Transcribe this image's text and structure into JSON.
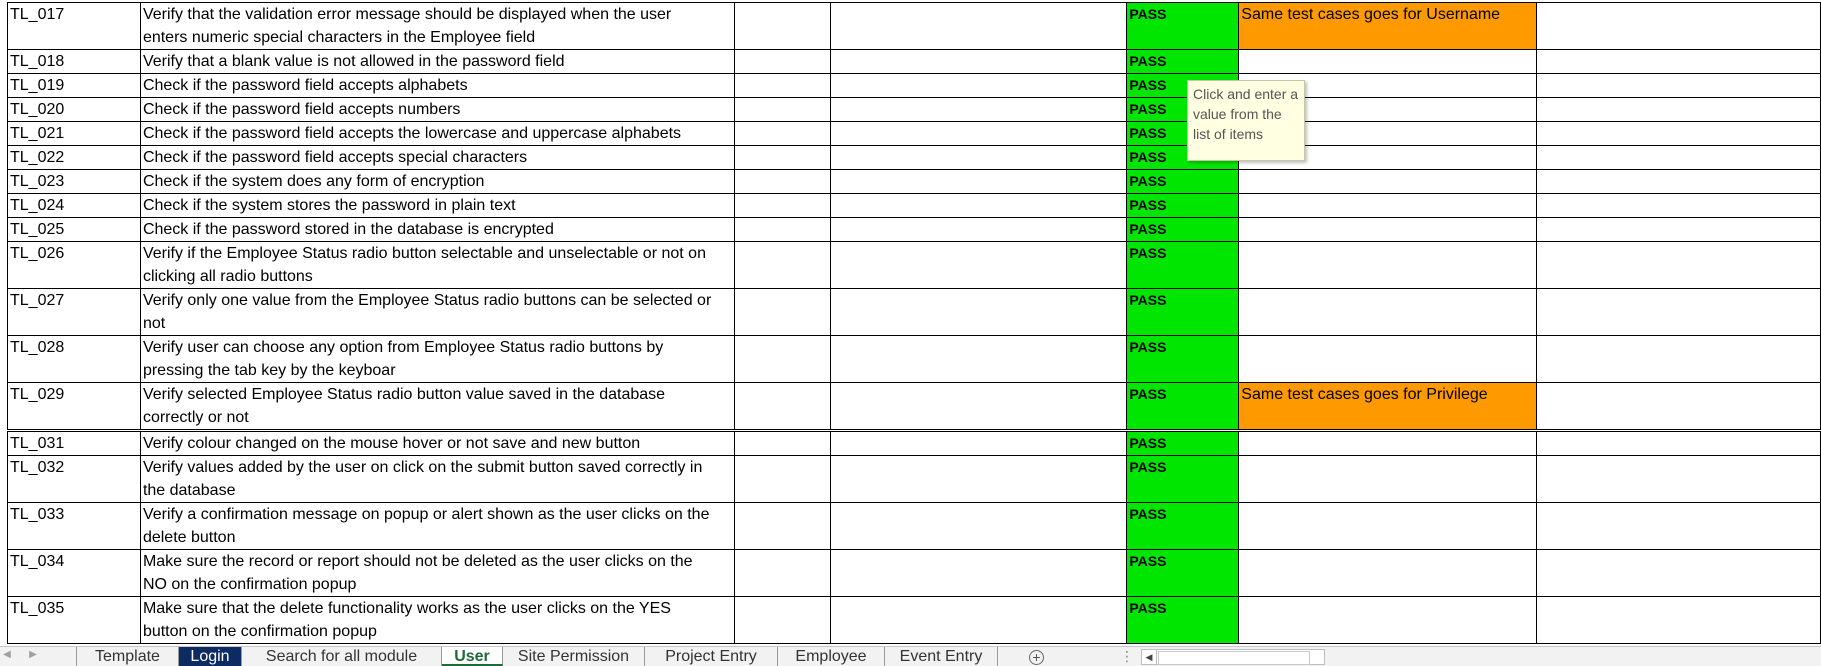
{
  "rows": [
    {
      "id": "TL_017",
      "desc1": "Verify that the validation error message should be displayed when the user",
      "desc2": "enters numeric special characters in the Employee field",
      "status": "PASS",
      "remark": "Same test cases goes for Username"
    },
    {
      "id": "TL_018",
      "desc1": "Verify that a blank value is not allowed in the password field",
      "desc2": "",
      "status": "PASS",
      "remark": ""
    },
    {
      "id": "TL_019",
      "desc1": "Check if the password field accepts alphabets",
      "desc2": "",
      "status": "PASS",
      "remark": ""
    },
    {
      "id": "TL_020",
      "desc1": "Check if the password field accepts numbers",
      "desc2": "",
      "status": "PASS",
      "remark": ""
    },
    {
      "id": "TL_021",
      "desc1": "Check if the password field accepts the lowercase and uppercase alphabets",
      "desc2": "",
      "status": "PASS",
      "remark": ""
    },
    {
      "id": "TL_022",
      "desc1": "Check if the password field accepts special characters",
      "desc2": "",
      "status": "PASS",
      "remark": ""
    },
    {
      "id": "TL_023",
      "desc1": "Check if the system does any form of encryption",
      "desc2": "",
      "status": "PASS",
      "remark": ""
    },
    {
      "id": "TL_024",
      "desc1": "Check if the system stores the password in plain text",
      "desc2": "",
      "status": "PASS",
      "remark": ""
    },
    {
      "id": "TL_025",
      "desc1": "Check if the password stored in the database is encrypted",
      "desc2": "",
      "status": "PASS",
      "remark": ""
    },
    {
      "id": "TL_026",
      "desc1": "Verify if the Employee Status radio button selectable and unselectable or not on",
      "desc2": "clicking all radio buttons",
      "status": "PASS",
      "remark": ""
    },
    {
      "id": "TL_027",
      "desc1": "Verify only one value from the Employee Status radio buttons can be selected or",
      "desc2": "not",
      "status": "PASS",
      "remark": ""
    },
    {
      "id": "TL_028",
      "desc1": "Verify user can choose any option from Employee Status radio buttons by",
      "desc2": "pressing the tab key by the keyboar",
      "status": "PASS",
      "remark": ""
    },
    {
      "id": "TL_029",
      "desc1": "Verify selected Employee Status radio button value saved in the database",
      "desc2": "correctly or not",
      "status": "PASS",
      "remark": "Same test cases goes for Privilege"
    },
    {
      "id": "TL_031",
      "desc1": "Verify colour changed on the mouse hover or not save and new button",
      "desc2": "",
      "status": "PASS",
      "remark": ""
    },
    {
      "id": "TL_032",
      "desc1": "Verify values added by the user on click on the submit button saved correctly in",
      "desc2": "the database",
      "status": "PASS",
      "remark": ""
    },
    {
      "id": "TL_033",
      "desc1": "Verify a confirmation message on popup or alert shown as the user clicks on the",
      "desc2": "delete button",
      "status": "PASS",
      "remark": ""
    },
    {
      "id": "TL_034",
      "desc1": "Make sure the record or report should not be deleted as the user clicks on the",
      "desc2": "NO on the confirmation popup",
      "status": "PASS",
      "remark": ""
    },
    {
      "id": "TL_035",
      "desc1": "Make sure that the delete functionality works as the user clicks on the YES",
      "desc2": "button on the confirmation popup",
      "status": "PASS",
      "remark": ""
    }
  ],
  "tooltip": {
    "text": "Click and enter a value from the list of items"
  },
  "tabs": [
    "Template",
    "Login",
    "Search for all module",
    "User",
    "Site Permission",
    "Project Entry",
    "Employee",
    "Event Entry"
  ],
  "active_tab": "User",
  "colors": {
    "pass_fill": "#00e600",
    "remark_fill": "#ff9900",
    "login_tab": "#0c2b63",
    "active_tab_text": "#1e6b38"
  },
  "icons": {
    "add_sheet": "plus-circle-icon",
    "prev": "left-arrow-icon",
    "next": "right-arrow-icon"
  }
}
